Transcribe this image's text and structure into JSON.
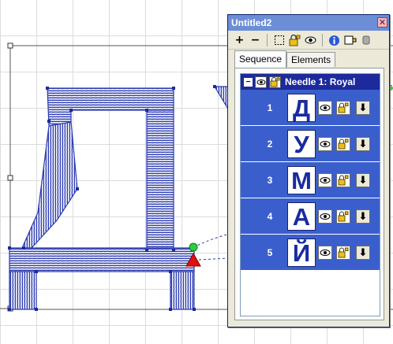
{
  "window": {
    "title": "Untitled2",
    "close_glyph": "✕"
  },
  "toolbar": {
    "items": [
      {
        "label": "+",
        "icon": "add-icon"
      },
      {
        "label": "−",
        "icon": "remove-icon"
      },
      {
        "icon": "select-box-icon"
      },
      {
        "icon": "lock-icon"
      },
      {
        "icon": "eye-icon"
      },
      {
        "icon": "info-icon"
      },
      {
        "icon": "color-swatch-icon"
      },
      {
        "icon": "more-icon"
      }
    ]
  },
  "tabs": [
    {
      "label": "Sequence",
      "active": true
    },
    {
      "label": "Elements",
      "active": false
    }
  ],
  "needle": {
    "label": "Needle 1: Royal",
    "collapse_glyph": "−"
  },
  "sequence": [
    {
      "number": "1",
      "letter": "Д"
    },
    {
      "number": "2",
      "letter": "У"
    },
    {
      "number": "3",
      "letter": "М"
    },
    {
      "number": "4",
      "letter": "А"
    },
    {
      "number": "5",
      "letter": "Й"
    }
  ],
  "row_down_glyph": "⬇",
  "colors": {
    "stitch": "#2b3bb0",
    "row_bg": "#3a5fcd",
    "needle_header": "#1d2a9c",
    "title_bar": "#6b8ed6",
    "start_marker": "#2ecc40",
    "end_marker": "#e01010"
  }
}
